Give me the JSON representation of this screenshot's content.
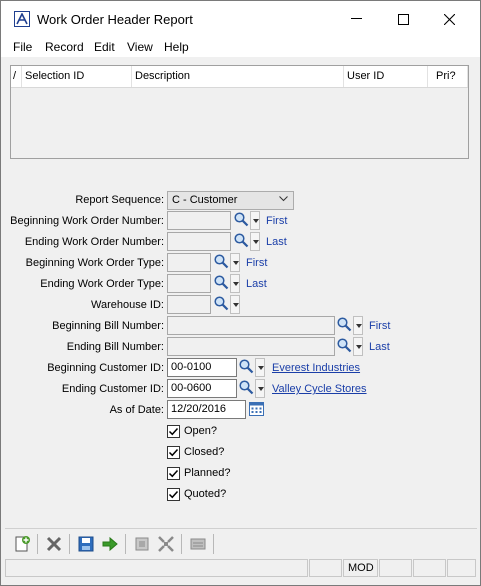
{
  "window": {
    "title": "Work Order Header Report"
  },
  "menu": [
    "File",
    "Record",
    "Edit",
    "View",
    "Help"
  ],
  "grid": {
    "columns": [
      "/",
      "Selection ID",
      "Description",
      "User ID",
      "Pri?"
    ]
  },
  "form": {
    "report_sequence_label": "Report Sequence:",
    "report_sequence_value": "C - Customer",
    "beg_wo_number_label": "Beginning Work Order Number:",
    "end_wo_number_label": "Ending Work Order Number:",
    "beg_wo_type_label": "Beginning Work Order Type:",
    "end_wo_type_label": "Ending Work Order Type:",
    "warehouse_label": "Warehouse ID:",
    "beg_bill_label": "Beginning Bill Number:",
    "end_bill_label": "Ending Bill Number:",
    "beg_customer_label": "Beginning Customer ID:",
    "beg_customer_value": "00-0100",
    "beg_customer_name": "Everest Industries",
    "end_customer_label": "Ending Customer ID:",
    "end_customer_value": "00-0600",
    "end_customer_name": "Valley Cycle Stores",
    "as_of_label": "As of Date:",
    "as_of_value": "12/20/2016",
    "first": "First",
    "last": "Last",
    "checkboxes": [
      {
        "label": "Open?",
        "checked": true
      },
      {
        "label": "Closed?",
        "checked": true
      },
      {
        "label": "Planned?",
        "checked": true
      },
      {
        "label": "Quoted?",
        "checked": true
      }
    ]
  },
  "status": {
    "mode": "MOD"
  },
  "colors": {
    "link": "#1a3ea8",
    "accent": "#1f3f8f"
  }
}
